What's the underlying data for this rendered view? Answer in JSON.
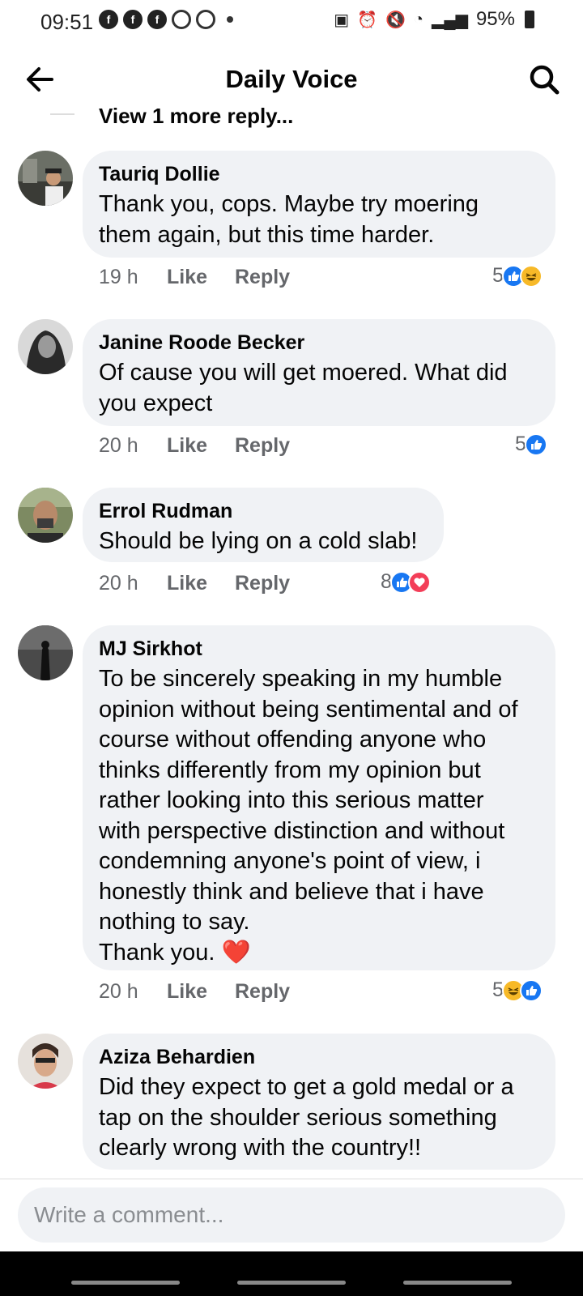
{
  "status_bar": {
    "time": "09:51",
    "battery": "95%"
  },
  "header": {
    "title": "Daily Voice"
  },
  "view_more": "View 1 more reply...",
  "comments": [
    {
      "author": "Tauriq Dollie",
      "text": "Thank you, cops. Maybe try moering\nthem again, but this time harder.",
      "time": "19 h",
      "like": "Like",
      "reply": "Reply",
      "reaction_count": "5",
      "reactions": [
        "like",
        "haha"
      ]
    },
    {
      "author": "Janine Roode Becker",
      "text": "Of cause you will get moered. What did\nyou expect",
      "time": "20 h",
      "like": "Like",
      "reply": "Reply",
      "reaction_count": "5",
      "reactions": [
        "like"
      ]
    },
    {
      "author": "Errol Rudman",
      "text": "Should be lying on a cold slab!",
      "time": "20 h",
      "like": "Like",
      "reply": "Reply",
      "reaction_count": "8",
      "reactions": [
        "like",
        "love"
      ]
    },
    {
      "author": "MJ Sirkhot",
      "text": "To be sincerely speaking in my humble\nopinion without being sentimental and of\ncourse without offending anyone who\nthinks differently from my opinion but\nrather looking into this serious matter\nwith perspective distinction and without\ncondemning anyone's point of view, i\nhonestly think and believe that i have\nnothing to say.\nThank you. ❤️",
      "time": "20 h",
      "like": "Like",
      "reply": "Reply",
      "reaction_count": "5",
      "reactions": [
        "haha",
        "like"
      ]
    },
    {
      "author": "Aziza Behardien",
      "text": "Did they expect to get a gold medal or a\ntap on the shoulder serious something\nclearly wrong with the country!!"
    }
  ],
  "composer": {
    "placeholder": "Write a comment..."
  },
  "colors": {
    "bubble": "#f0f2f5",
    "like_blue": "#1877f2",
    "haha_yellow": "#f7b928",
    "love_red": "#f33e58",
    "meta_gray": "#65676b"
  }
}
